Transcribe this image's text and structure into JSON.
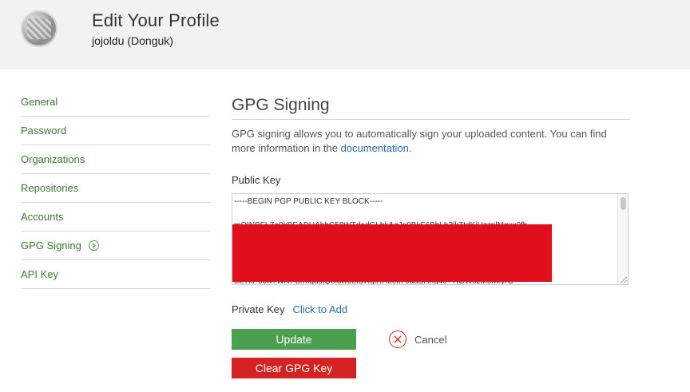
{
  "header": {
    "title": "Edit Your Profile",
    "user": "jojoldu (Donguk)"
  },
  "sidebar": {
    "items": [
      {
        "label": "General"
      },
      {
        "label": "Password"
      },
      {
        "label": "Organizations"
      },
      {
        "label": "Repositories"
      },
      {
        "label": "Accounts"
      },
      {
        "label": "GPG Signing",
        "icon": "chevron-right-icon",
        "active": true
      },
      {
        "label": "API Key"
      }
    ]
  },
  "main": {
    "section_title": "GPG Signing",
    "description_text": "GPG signing allows you to automatically sign your uploaded content. You can find more information in the ",
    "description_link": "documentation",
    "description_end": ".",
    "public_key_label": "Public Key",
    "public_key_lines": [
      "-----BEGIN PGP PUBLIC KEY BLOCK-----",
      "mQINBFLZa0kBEADUAbbC58WTdadGLbkAgJo0BkF6BbLh3lkTtdKiHzzplMgxx0fb",
      "cle7xP0cw7W/vFB/mga9lQol3w6uIDRqlHHbek70aaSHng4c+TIOWozM8iwlyrO"
    ],
    "private_key_label": "Private Key",
    "private_key_action": "Click to Add",
    "update_button": "Update",
    "cancel_label": "Cancel",
    "clear_button": "Clear GPG Key"
  },
  "colors": {
    "link_green": "#3a7a31",
    "link_blue": "#2a6ba5",
    "update_green": "#4aa04f",
    "danger_red": "#d52324"
  }
}
